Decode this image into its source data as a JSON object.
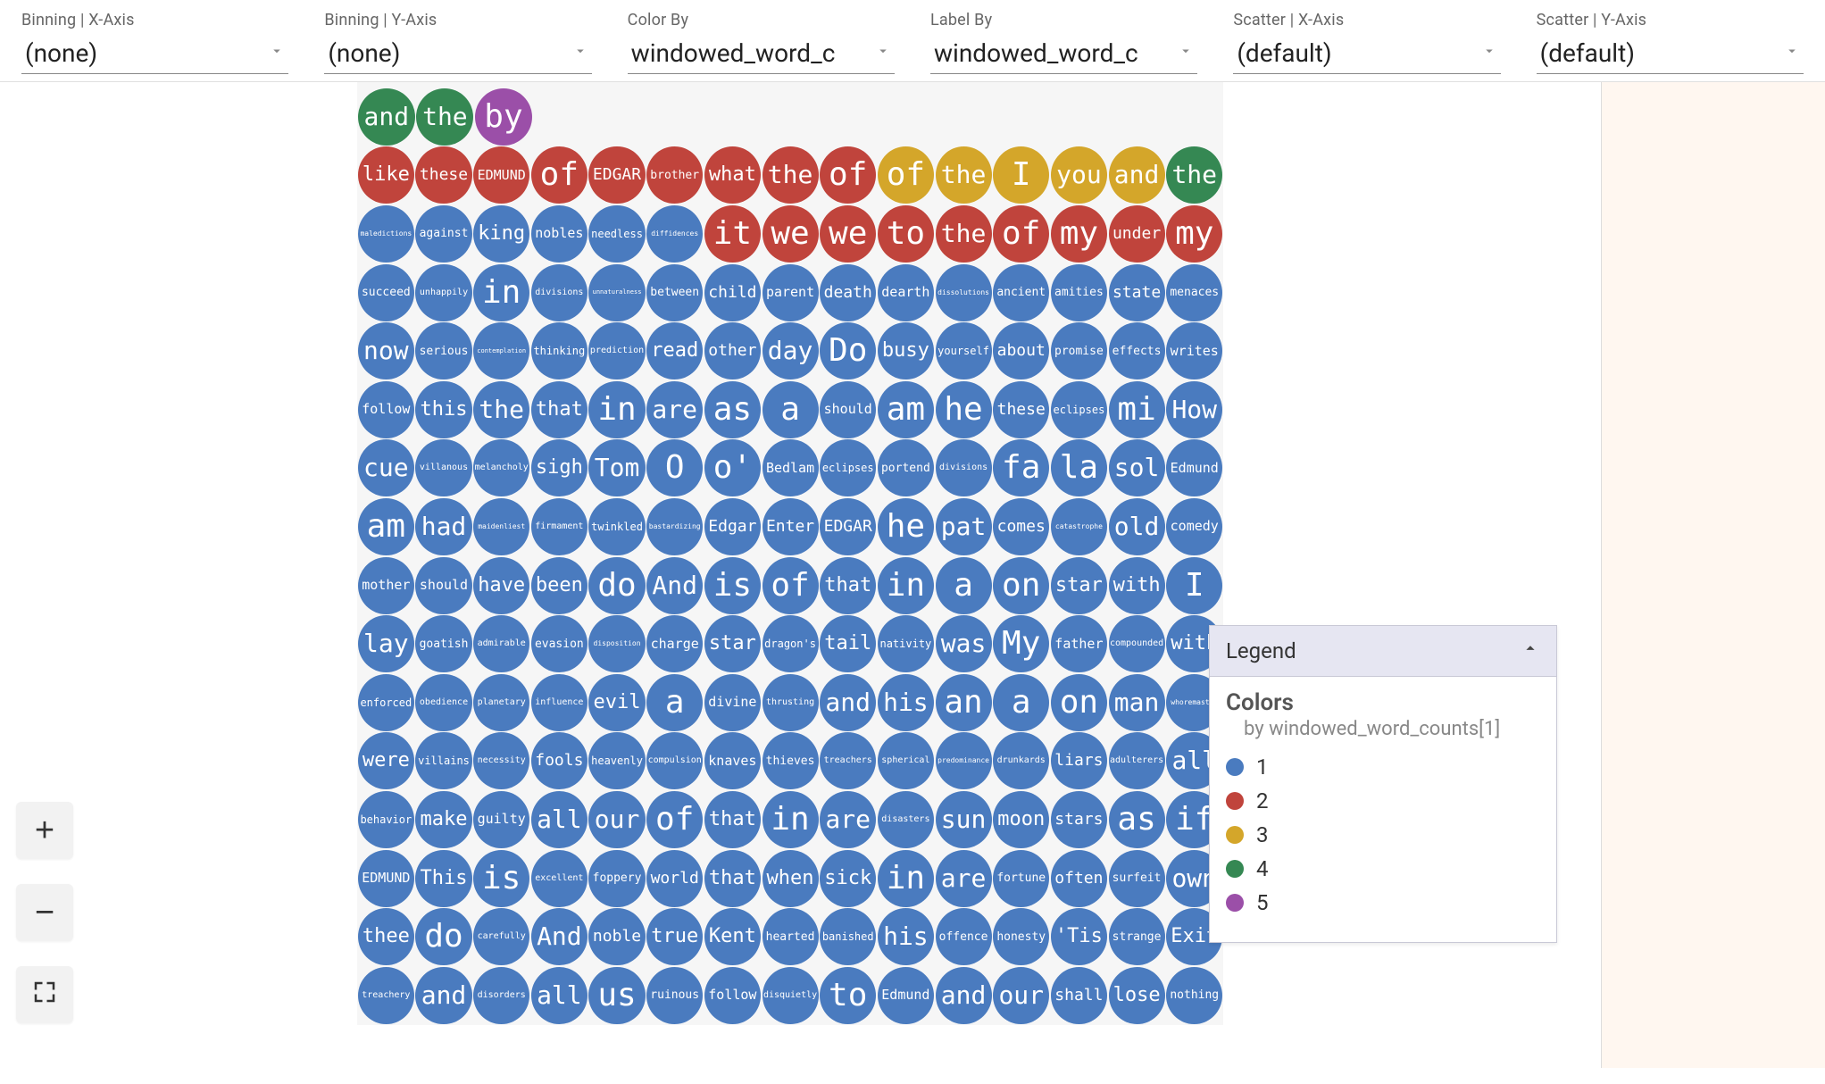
{
  "controls": [
    {
      "label": "Binning | X-Axis",
      "value": "(none)"
    },
    {
      "label": "Binning | Y-Axis",
      "value": "(none)"
    },
    {
      "label": "Color By",
      "value": "windowed_word_c"
    },
    {
      "label": "Label By",
      "value": "windowed_word_c"
    },
    {
      "label": "Scatter | X-Axis",
      "value": "(default)"
    },
    {
      "label": "Scatter | Y-Axis",
      "value": "(default)"
    }
  ],
  "legend": {
    "header": "Legend",
    "title": "Colors",
    "subtitle": "by windowed_word_counts[1]",
    "entries": [
      {
        "label": "1",
        "color": "#4a7bbf"
      },
      {
        "label": "2",
        "color": "#c0443c"
      },
      {
        "label": "3",
        "color": "#d4a62a"
      },
      {
        "label": "4",
        "color": "#358853"
      },
      {
        "label": "5",
        "color": "#9b4fa8"
      }
    ]
  },
  "zoom": {
    "in": "+",
    "out": "−",
    "fit": "⛶"
  },
  "colors": {
    "blue": "#4a7bbf",
    "red": "#c0443c",
    "yellow": "#d4a62a",
    "green": "#358853",
    "purple": "#9b4fa8",
    "stage_bg": "#f6f6f6",
    "right_strip": "#fff7f0"
  },
  "grid": [
    [
      {
        "t": "and",
        "c": 4
      },
      {
        "t": "the",
        "c": 4
      },
      {
        "t": "by",
        "c": 5
      }
    ],
    [
      {
        "t": "like",
        "c": 2
      },
      {
        "t": "these",
        "c": 2
      },
      {
        "t": "EDMUND",
        "c": 2
      },
      {
        "t": "of",
        "c": 2
      },
      {
        "t": "EDGAR",
        "c": 2
      },
      {
        "t": "brother",
        "c": 2
      },
      {
        "t": "what",
        "c": 2
      },
      {
        "t": "the",
        "c": 2
      },
      {
        "t": "of",
        "c": 2
      },
      {
        "t": "of",
        "c": 3
      },
      {
        "t": "the",
        "c": 3
      },
      {
        "t": "I",
        "c": 3
      },
      {
        "t": "you",
        "c": 3
      },
      {
        "t": "and",
        "c": 3
      },
      {
        "t": "the",
        "c": 4
      }
    ],
    [
      {
        "t": "maledictions",
        "c": 1
      },
      {
        "t": "against",
        "c": 1
      },
      {
        "t": "king",
        "c": 1
      },
      {
        "t": "nobles",
        "c": 1
      },
      {
        "t": "needless",
        "c": 1
      },
      {
        "t": "diffidences",
        "c": 1
      },
      {
        "t": "it",
        "c": 2
      },
      {
        "t": "we",
        "c": 2
      },
      {
        "t": "we",
        "c": 2
      },
      {
        "t": "to",
        "c": 2
      },
      {
        "t": "the",
        "c": 2
      },
      {
        "t": "of",
        "c": 2
      },
      {
        "t": "my",
        "c": 2
      },
      {
        "t": "under",
        "c": 2
      },
      {
        "t": "my",
        "c": 2
      }
    ],
    [
      {
        "t": "succeed",
        "c": 1
      },
      {
        "t": "unhappily",
        "c": 1
      },
      {
        "t": "in",
        "c": 1
      },
      {
        "t": "divisions",
        "c": 1
      },
      {
        "t": "unnaturalness",
        "c": 1
      },
      {
        "t": "between",
        "c": 1
      },
      {
        "t": "child",
        "c": 1
      },
      {
        "t": "parent",
        "c": 1
      },
      {
        "t": "death",
        "c": 1
      },
      {
        "t": "dearth",
        "c": 1
      },
      {
        "t": "dissolutions",
        "c": 1
      },
      {
        "t": "ancient",
        "c": 1
      },
      {
        "t": "amities",
        "c": 1
      },
      {
        "t": "state",
        "c": 1
      },
      {
        "t": "menaces",
        "c": 1
      }
    ],
    [
      {
        "t": "now",
        "c": 1
      },
      {
        "t": "serious",
        "c": 1
      },
      {
        "t": "contemplation",
        "c": 1
      },
      {
        "t": "thinking",
        "c": 1
      },
      {
        "t": "prediction",
        "c": 1
      },
      {
        "t": "read",
        "c": 1
      },
      {
        "t": "other",
        "c": 1
      },
      {
        "t": "day",
        "c": 1
      },
      {
        "t": "Do",
        "c": 1
      },
      {
        "t": "busy",
        "c": 1
      },
      {
        "t": "yourself",
        "c": 1
      },
      {
        "t": "about",
        "c": 1
      },
      {
        "t": "promise",
        "c": 1
      },
      {
        "t": "effects",
        "c": 1
      },
      {
        "t": "writes",
        "c": 1
      }
    ],
    [
      {
        "t": "follow",
        "c": 1
      },
      {
        "t": "this",
        "c": 1
      },
      {
        "t": "the",
        "c": 1
      },
      {
        "t": "that",
        "c": 1
      },
      {
        "t": "in",
        "c": 1
      },
      {
        "t": "are",
        "c": 1
      },
      {
        "t": "as",
        "c": 1
      },
      {
        "t": "a",
        "c": 1
      },
      {
        "t": "should",
        "c": 1
      },
      {
        "t": "am",
        "c": 1
      },
      {
        "t": "he",
        "c": 1
      },
      {
        "t": "these",
        "c": 1
      },
      {
        "t": "eclipses",
        "c": 1
      },
      {
        "t": "mi",
        "c": 1
      },
      {
        "t": "How",
        "c": 1
      }
    ],
    [
      {
        "t": "cue",
        "c": 1
      },
      {
        "t": "villanous",
        "c": 1
      },
      {
        "t": "melancholy",
        "c": 1
      },
      {
        "t": "sigh",
        "c": 1
      },
      {
        "t": "Tom",
        "c": 1
      },
      {
        "t": "O",
        "c": 1
      },
      {
        "t": "o'",
        "c": 1
      },
      {
        "t": "Bedlam",
        "c": 1
      },
      {
        "t": "eclipses",
        "c": 1
      },
      {
        "t": "portend",
        "c": 1
      },
      {
        "t": "divisions",
        "c": 1
      },
      {
        "t": "fa",
        "c": 1
      },
      {
        "t": "la",
        "c": 1
      },
      {
        "t": "sol",
        "c": 1
      },
      {
        "t": "Edmund",
        "c": 1
      }
    ],
    [
      {
        "t": "am",
        "c": 1
      },
      {
        "t": "had",
        "c": 1
      },
      {
        "t": "maidenliest",
        "c": 1
      },
      {
        "t": "firmament",
        "c": 1
      },
      {
        "t": "twinkled",
        "c": 1
      },
      {
        "t": "bastardizing",
        "c": 1
      },
      {
        "t": "Edgar",
        "c": 1
      },
      {
        "t": "Enter",
        "c": 1
      },
      {
        "t": "EDGAR",
        "c": 1
      },
      {
        "t": "he",
        "c": 1
      },
      {
        "t": "pat",
        "c": 1
      },
      {
        "t": "comes",
        "c": 1
      },
      {
        "t": "catastrophe",
        "c": 1
      },
      {
        "t": "old",
        "c": 1
      },
      {
        "t": "comedy",
        "c": 1
      }
    ],
    [
      {
        "t": "mother",
        "c": 1
      },
      {
        "t": "should",
        "c": 1
      },
      {
        "t": "have",
        "c": 1
      },
      {
        "t": "been",
        "c": 1
      },
      {
        "t": "do",
        "c": 1
      },
      {
        "t": "And",
        "c": 1
      },
      {
        "t": "is",
        "c": 1
      },
      {
        "t": "of",
        "c": 1
      },
      {
        "t": "that",
        "c": 1
      },
      {
        "t": "in",
        "c": 1
      },
      {
        "t": "a",
        "c": 1
      },
      {
        "t": "on",
        "c": 1
      },
      {
        "t": "star",
        "c": 1
      },
      {
        "t": "with",
        "c": 1
      },
      {
        "t": "I",
        "c": 1
      }
    ],
    [
      {
        "t": "lay",
        "c": 1
      },
      {
        "t": "goatish",
        "c": 1
      },
      {
        "t": "admirable",
        "c": 1
      },
      {
        "t": "evasion",
        "c": 1
      },
      {
        "t": "disposition",
        "c": 1
      },
      {
        "t": "charge",
        "c": 1
      },
      {
        "t": "star",
        "c": 1
      },
      {
        "t": "dragon's",
        "c": 1
      },
      {
        "t": "tail",
        "c": 1
      },
      {
        "t": "nativity",
        "c": 1
      },
      {
        "t": "was",
        "c": 1
      },
      {
        "t": "My",
        "c": 1
      },
      {
        "t": "father",
        "c": 1
      },
      {
        "t": "compounded",
        "c": 1
      },
      {
        "t": "with",
        "c": 1
      }
    ],
    [
      {
        "t": "enforced",
        "c": 1
      },
      {
        "t": "obedience",
        "c": 1
      },
      {
        "t": "planetary",
        "c": 1
      },
      {
        "t": "influence",
        "c": 1
      },
      {
        "t": "evil",
        "c": 1
      },
      {
        "t": "a",
        "c": 1
      },
      {
        "t": "divine",
        "c": 1
      },
      {
        "t": "thrusting",
        "c": 1
      },
      {
        "t": "and",
        "c": 1
      },
      {
        "t": "his",
        "c": 1
      },
      {
        "t": "an",
        "c": 1
      },
      {
        "t": "a",
        "c": 1
      },
      {
        "t": "on",
        "c": 1
      },
      {
        "t": "man",
        "c": 1
      },
      {
        "t": "whoremaster",
        "c": 1
      }
    ],
    [
      {
        "t": "were",
        "c": 1
      },
      {
        "t": "villains",
        "c": 1
      },
      {
        "t": "necessity",
        "c": 1
      },
      {
        "t": "fools",
        "c": 1
      },
      {
        "t": "heavenly",
        "c": 1
      },
      {
        "t": "compulsion",
        "c": 1
      },
      {
        "t": "knaves",
        "c": 1
      },
      {
        "t": "thieves",
        "c": 1
      },
      {
        "t": "treachers",
        "c": 1
      },
      {
        "t": "spherical",
        "c": 1
      },
      {
        "t": "predominance",
        "c": 1
      },
      {
        "t": "drunkards",
        "c": 1
      },
      {
        "t": "liars",
        "c": 1
      },
      {
        "t": "adulterers",
        "c": 1
      },
      {
        "t": "all",
        "c": 1
      }
    ],
    [
      {
        "t": "behavior",
        "c": 1
      },
      {
        "t": "make",
        "c": 1
      },
      {
        "t": "guilty",
        "c": 1
      },
      {
        "t": "all",
        "c": 1
      },
      {
        "t": "our",
        "c": 1
      },
      {
        "t": "of",
        "c": 1
      },
      {
        "t": "that",
        "c": 1
      },
      {
        "t": "in",
        "c": 1
      },
      {
        "t": "are",
        "c": 1
      },
      {
        "t": "disasters",
        "c": 1
      },
      {
        "t": "sun",
        "c": 1
      },
      {
        "t": "moon",
        "c": 1
      },
      {
        "t": "stars",
        "c": 1
      },
      {
        "t": "as",
        "c": 1
      },
      {
        "t": "if",
        "c": 1
      }
    ],
    [
      {
        "t": "EDMUND",
        "c": 1
      },
      {
        "t": "This",
        "c": 1
      },
      {
        "t": "is",
        "c": 1
      },
      {
        "t": "excellent",
        "c": 1
      },
      {
        "t": "foppery",
        "c": 1
      },
      {
        "t": "world",
        "c": 1
      },
      {
        "t": "that",
        "c": 1
      },
      {
        "t": "when",
        "c": 1
      },
      {
        "t": "sick",
        "c": 1
      },
      {
        "t": "in",
        "c": 1
      },
      {
        "t": "are",
        "c": 1
      },
      {
        "t": "fortune",
        "c": 1
      },
      {
        "t": "often",
        "c": 1
      },
      {
        "t": "surfeit",
        "c": 1
      },
      {
        "t": "own",
        "c": 1
      }
    ],
    [
      {
        "t": "thee",
        "c": 1
      },
      {
        "t": "do",
        "c": 1
      },
      {
        "t": "carefully",
        "c": 1
      },
      {
        "t": "And",
        "c": 1
      },
      {
        "t": "noble",
        "c": 1
      },
      {
        "t": "true",
        "c": 1
      },
      {
        "t": "Kent",
        "c": 1
      },
      {
        "t": "hearted",
        "c": 1
      },
      {
        "t": "banished",
        "c": 1
      },
      {
        "t": "his",
        "c": 1
      },
      {
        "t": "offence",
        "c": 1
      },
      {
        "t": "honesty",
        "c": 1
      },
      {
        "t": "'Tis",
        "c": 1
      },
      {
        "t": "strange",
        "c": 1
      },
      {
        "t": "Exit",
        "c": 1
      }
    ],
    [
      {
        "t": "treachery",
        "c": 1
      },
      {
        "t": "and",
        "c": 1
      },
      {
        "t": "disorders",
        "c": 1
      },
      {
        "t": "all",
        "c": 1
      },
      {
        "t": "us",
        "c": 1
      },
      {
        "t": "ruinous",
        "c": 1
      },
      {
        "t": "follow",
        "c": 1
      },
      {
        "t": "disquietly",
        "c": 1
      },
      {
        "t": "to",
        "c": 1
      },
      {
        "t": "Edmund",
        "c": 1
      },
      {
        "t": "and",
        "c": 1
      },
      {
        "t": "our",
        "c": 1
      },
      {
        "t": "shall",
        "c": 1
      },
      {
        "t": "lose",
        "c": 1
      },
      {
        "t": "nothing",
        "c": 1
      }
    ]
  ]
}
